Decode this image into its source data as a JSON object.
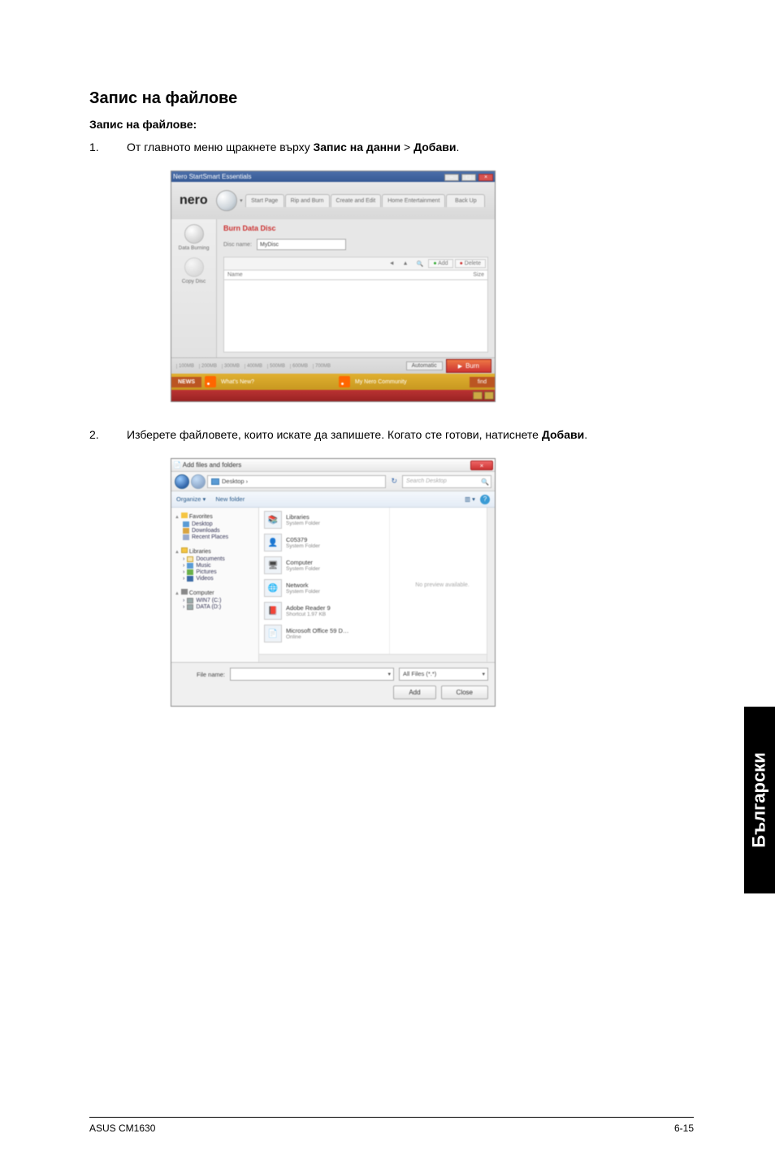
{
  "page": {
    "title": "Запис на файлове",
    "subtitle": "Запис на файлове:",
    "footer_left": "ASUS CM1630",
    "footer_right": "6-15",
    "side_tab": "Български"
  },
  "steps": {
    "s1_num": "1.",
    "s1_a": "От главното меню щракнете върху ",
    "s1_b": "Запис на данни",
    "s1_c": " > ",
    "s1_d": "Добави",
    "s1_e": ".",
    "s2_num": "2.",
    "s2_a": "Изберете файловете, които искате да запишете. Когато сте готови, натиснете ",
    "s2_b": "Добави",
    "s2_c": "."
  },
  "nero": {
    "title": "Nero StartSmart Essentials",
    "logo": "nero",
    "tabs": [
      "Start Page",
      "Rip and Burn",
      "Create and Edit",
      "Home Entertainment",
      "Back Up"
    ],
    "left": {
      "item1": "Data Burning",
      "item2": "Copy Disc"
    },
    "header": "Burn Data Disc",
    "disc_label": "Disc name:",
    "disc_value": "MyDisc",
    "toolbar_add": "Add",
    "toolbar_delete": "Delete",
    "col_name": "Name",
    "col_size": "Size",
    "ruler": [
      "100MB",
      "200MB",
      "300MB",
      "400MB",
      "500MB",
      "600MB",
      "700MB"
    ],
    "auto": "Automatic",
    "burn": "Burn",
    "news_label": "NEWS",
    "news_item1": "What's New?",
    "news_item2": "My Nero Community",
    "news_end": "find"
  },
  "dialog": {
    "title": "Add files and folders",
    "crumb": "Desktop  ›",
    "search_placeholder": "Search Desktop",
    "organize": "Organize ▾",
    "newfolder": "New folder",
    "view_icon": "▥ ▾",
    "help": "?",
    "tree": {
      "favorites": "Favorites",
      "desktop": "Desktop",
      "downloads": "Downloads",
      "recent": "Recent Places",
      "libraries": "Libraries",
      "documents": "Documents",
      "music": "Music",
      "pictures": "Pictures",
      "videos": "Videos",
      "computer": "Computer",
      "drive_c": "WIN7 (C:)",
      "drive_d": "DATA (D:)"
    },
    "files": [
      {
        "name": "Libraries",
        "sub": "System Folder",
        "glyph": "📚"
      },
      {
        "name": "C05379",
        "sub": "System Folder",
        "glyph": "👤"
      },
      {
        "name": "Computer",
        "sub": "System Folder",
        "glyph": "🖥"
      },
      {
        "name": "Network",
        "sub": "System Folder",
        "glyph": "🌐"
      },
      {
        "name": "Adobe Reader 9",
        "sub": "Shortcut\n1.97 KB",
        "glyph": "📕"
      },
      {
        "name": "Microsoft Office 59 D…",
        "sub": "Online",
        "glyph": "📄"
      }
    ],
    "preview_text": "No preview available.",
    "filename_label": "File name:",
    "filename_value": "",
    "filter": "All Files (*.*)",
    "btn_add": "Add",
    "btn_close": "Close"
  }
}
